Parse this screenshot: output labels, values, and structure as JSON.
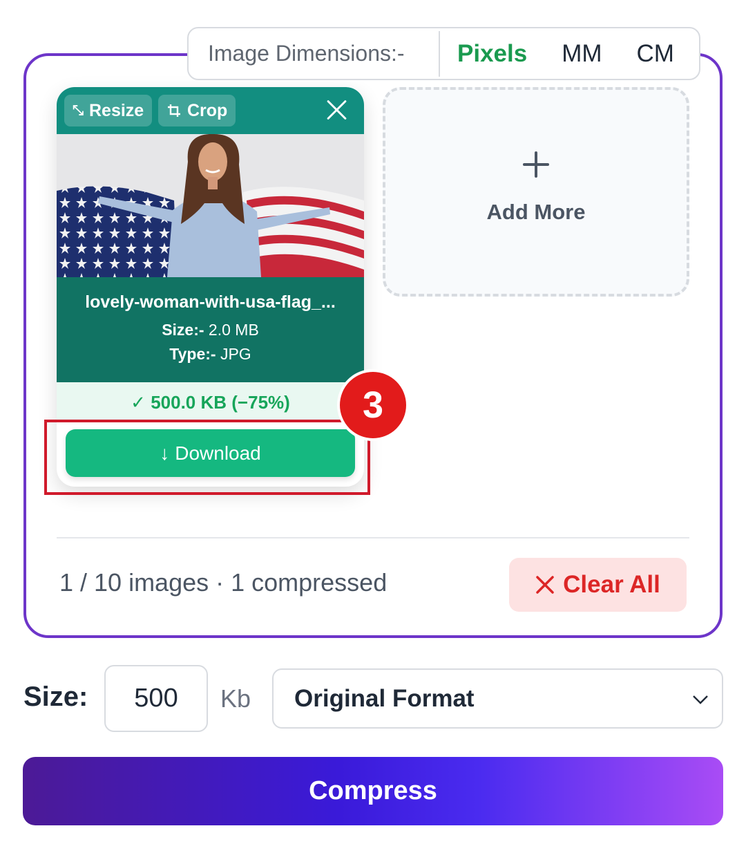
{
  "dimensions": {
    "label": "Image Dimensions:-",
    "options": [
      "Pixels",
      "MM",
      "CM"
    ],
    "active": "Pixels"
  },
  "card": {
    "resize_label": "Resize",
    "crop_label": "Crop",
    "filename": "lovely-woman-with-usa-flag_...",
    "size_label": "Size:-",
    "size_value": "2.0 MB",
    "type_label": "Type:-",
    "type_value": "JPG",
    "result": "500.0 KB (−75%)",
    "download_label": "Download",
    "download_arrow": "↓"
  },
  "step_badge": "3",
  "add_more": {
    "label": "Add More"
  },
  "status": {
    "count_text": "1 / 10 images · 1 compressed",
    "clear_label": "Clear All"
  },
  "controls": {
    "size_label": "Size:",
    "size_value": "500",
    "unit": "Kb",
    "format_value": "Original Format"
  },
  "compress_label": "Compress",
  "colors": {
    "panel_border": "#6d35c9",
    "card_header": "#128e80",
    "card_info": "#117363",
    "download": "#15b880",
    "highlight": "#d01a2b",
    "badge": "#e21b1b",
    "active_option": "#1a9a4f",
    "clear_text": "#dc2626"
  },
  "icons": [
    "resize-icon",
    "crop-icon",
    "close-icon",
    "check-icon",
    "download-arrow-icon",
    "plus-icon",
    "x-icon",
    "chevron-down-icon"
  ]
}
